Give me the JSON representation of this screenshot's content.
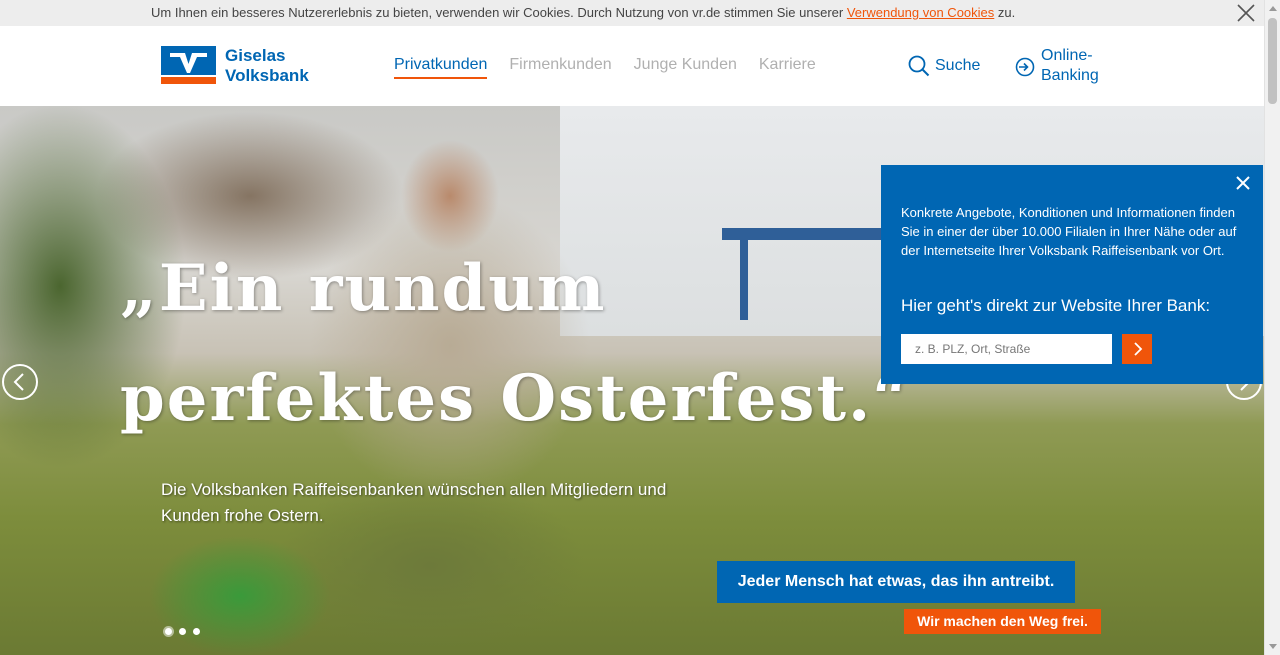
{
  "cookie": {
    "text": "Um Ihnen ein besseres Nutzererlebnis zu bieten, verwenden wir Cookies. Durch Nutzung von vr.de stimmen Sie unserer ",
    "link": "Verwendung von Cookies",
    "suffix": " zu."
  },
  "header": {
    "logo_line1": "Giselas",
    "logo_line2": "Volksbank",
    "nav": [
      "Privatkunden",
      "Firmenkunden",
      "Junge Kunden",
      "Karriere"
    ],
    "search_label": "Suche",
    "online_line1": "Online-",
    "online_line2": "Banking"
  },
  "hero": {
    "headline_line1": "„Ein rundum",
    "headline_line2": "perfektes Osterfest.“",
    "subtext": "Die Volksbanken Raiffeisenbanken wünschen allen Mitgliedern und Kunden frohe Ostern.",
    "slogan1": "Jeder Mensch hat etwas, das ihn antreibt.",
    "slogan2": "Wir machen den Weg frei.",
    "slide_count": 3,
    "active_slide": 1
  },
  "popup": {
    "text": "Konkrete Angebote, Konditionen und Informationen finden Sie in einer der über 10.000 Filialen in Ihrer Nähe oder auf der Internetseite Ihrer Volksbank Raiffeisenbank vor Ort.",
    "cta": "Hier geht's direkt zur Website Ihrer Bank:",
    "placeholder": "z. B. PLZ, Ort, Straße"
  },
  "colors": {
    "brand_blue": "#0066b3",
    "brand_orange": "#f0550a"
  }
}
